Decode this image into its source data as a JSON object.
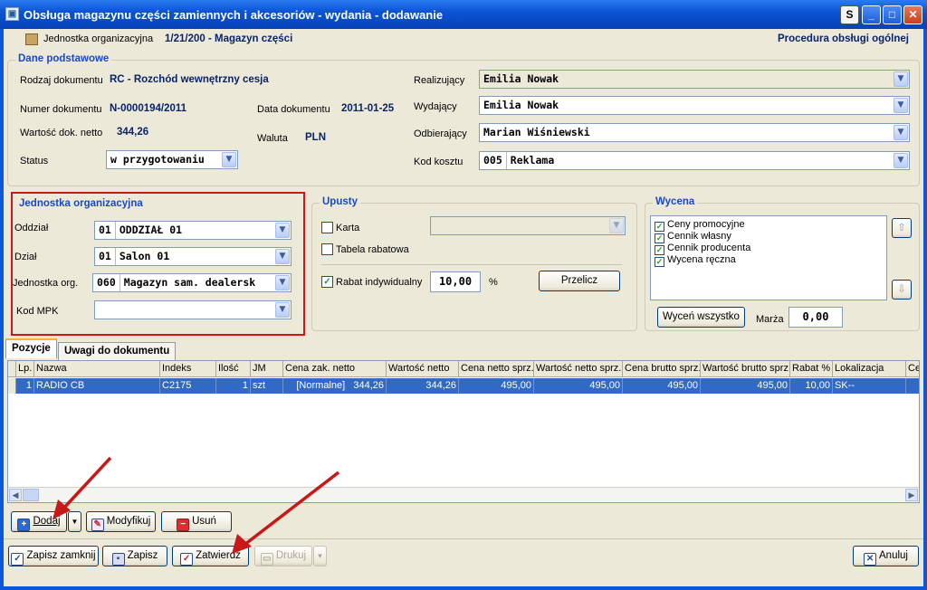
{
  "window": {
    "title": "Obsługa magazynu części zamiennych i akcesoriów - wydania -  dodawanie",
    "btn_s": "S"
  },
  "header": {
    "org_label": "Jednostka organizacyjna",
    "org_value": "1/21/200 - Magazyn części",
    "procedure": "Procedura obsługi ogólnej"
  },
  "basic": {
    "title": "Dane podstawowe",
    "doc_type_label": "Rodzaj dokumentu",
    "doc_type_value": "RC - Rozchód wewnętrzny cesja",
    "doc_no_label": "Numer dokumentu",
    "doc_no_value": "N-0000194/2011",
    "doc_date_label": "Data dokumentu",
    "doc_date_value": "2011-01-25",
    "net_label": "Wartość dok. netto",
    "net_value": "344,26",
    "currency_label": "Waluta",
    "currency_value": "PLN",
    "status_label": "Status",
    "status_value": "w przygotowaniu",
    "realizer_label": "Realizujący",
    "realizer_value": "Emilia Nowak",
    "issuer_label": "Wydający",
    "issuer_value": "Emilia Nowak",
    "receiver_label": "Odbierający",
    "receiver_value": "Marian Wiśniewski",
    "cost_label": "Kod kosztu",
    "cost_code": "005",
    "cost_value": "Reklama"
  },
  "org": {
    "title": "Jednostka organizacyjna",
    "branch_label": "Oddział",
    "branch_code": "01",
    "branch_value": "ODDZIAŁ 01",
    "dept_label": "Dział",
    "dept_code": "01",
    "dept_value": "Salon 01",
    "unit_label": "Jednostka org.",
    "unit_code": "060",
    "unit_value": "Magazyn sam. dealersk",
    "mpk_label": "Kod MPK",
    "mpk_value": ""
  },
  "discounts": {
    "title": "Upusty",
    "card_label": "Karta",
    "table_label": "Tabela rabatowa",
    "individual_label": "Rabat indywidualny",
    "individual_value": "10,00",
    "percent": "%",
    "recalc_button": "Przelicz"
  },
  "pricing": {
    "title": "Wycena",
    "items": [
      "Ceny promocyjne",
      "Cennik własny",
      "Cennik producenta",
      "Wycena ręczna"
    ],
    "price_all_button": "Wyceń wszystko",
    "margin_label": "Marża",
    "margin_value": "0,00"
  },
  "tabs": [
    "Pozycje",
    "Uwagi do dokumentu"
  ],
  "grid": {
    "columns": [
      "Lp.",
      "Nazwa",
      "Indeks",
      "Ilość",
      "JM",
      "Cena zak. netto",
      "Wartość netto",
      "Cena netto sprz.",
      "Wartość netto sprz.",
      "Cena brutto sprz.",
      "Wartość brutto sprz.",
      "Rabat %",
      "Lokalizacja",
      "Ce"
    ],
    "row": [
      "1",
      "RADIO CB",
      "C2175",
      "1",
      "szt",
      "[Normalne]   344,26",
      "344,26",
      "495,00",
      "495,00",
      "495,00",
      "495,00",
      "10,00",
      "SK--",
      ""
    ]
  },
  "actions": {
    "add": "Dodaj",
    "modify": "Modyfikuj",
    "delete": "Usuń",
    "save_close": "Zapisz zamknij",
    "save": "Zapisz",
    "confirm": "Zatwierdź",
    "print": "Drukuj",
    "cancel": "Anuluj"
  },
  "colors": {
    "title_blue": "#0b54d4",
    "highlight_red": "#c81818",
    "selected_row": "#3169c6"
  }
}
